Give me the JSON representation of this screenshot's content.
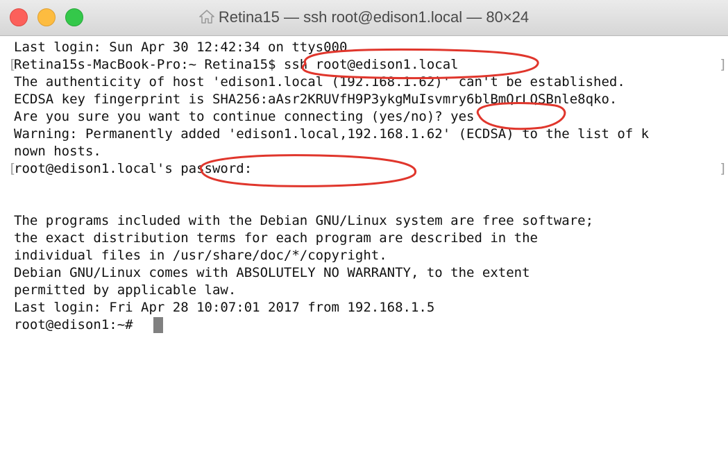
{
  "window": {
    "title": "Retina15 — ssh root@edison1.local — 80×24",
    "title_icon": "home-icon"
  },
  "terminal": {
    "lines": [
      "Last login: Sun Apr 30 12:42:34 on ttys000",
      "Retina15s-MacBook-Pro:~ Retina15$ ssh root@edison1.local",
      "The authenticity of host 'edison1.local (192.168.1.62)' can't be established.",
      "ECDSA key fingerprint is SHA256:aAsr2KRUVfH9P3ykgMuIsvmry6blBmQrLQSBnle8qko.",
      "Are you sure you want to continue connecting (yes/no)? yes",
      "Warning: Permanently added 'edison1.local,192.168.1.62' (ECDSA) to the list of k",
      "nown hosts.",
      "root@edison1.local's password:",
      "",
      "The programs included with the Debian GNU/Linux system are free software;",
      "the exact distribution terms for each program are described in the",
      "individual files in /usr/share/doc/*/copyright.",
      "",
      "Debian GNU/Linux comes with ABSOLUTELY NO WARRANTY, to the extent",
      "permitted by applicable law.",
      "Last login: Fri Apr 28 10:07:01 2017 from 192.168.1.5",
      "root@edison1:~# "
    ],
    "marked_lines": [
      1,
      7
    ]
  },
  "colors": {
    "text": "#111111",
    "annotation": "#e0362c",
    "cursor": "#808080",
    "close": "#fc605b",
    "minimize": "#fdbc40",
    "zoom": "#34c84a"
  }
}
